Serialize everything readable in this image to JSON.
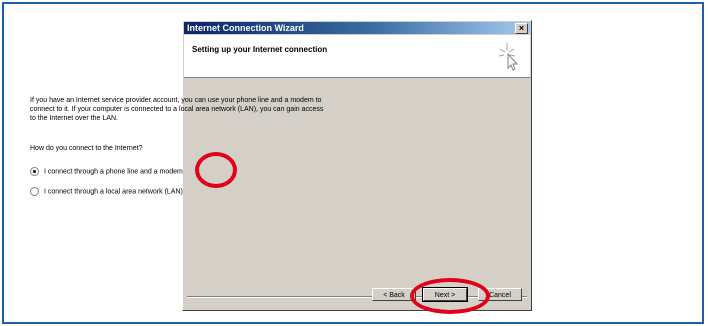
{
  "window": {
    "title": "Internet Connection Wizard",
    "close_glyph": "×"
  },
  "header": {
    "title": "Setting up your Internet connection",
    "icon": "wizard-pointer-icon"
  },
  "content": {
    "intro": "If you have an Internet service provider account, you can use your phone line and a modem to connect to it. If your computer is connected to a local area network (LAN), you can gain access to the Internet over the LAN.",
    "question": "How do you connect to the Internet?",
    "options": [
      {
        "label": "I connect through a phone line and a modem",
        "selected": true
      },
      {
        "label": "I connect through a local area network (LAN)",
        "selected": false
      }
    ]
  },
  "buttons": {
    "back": "< Back",
    "next": "Next >",
    "cancel": "Cancel"
  },
  "annotations": {
    "highlight_color": "#e0001a"
  },
  "colors": {
    "frame": "#1f5fa6",
    "titlebar_start": "#0a246a",
    "dialog_bg": "#d4d0c8"
  }
}
